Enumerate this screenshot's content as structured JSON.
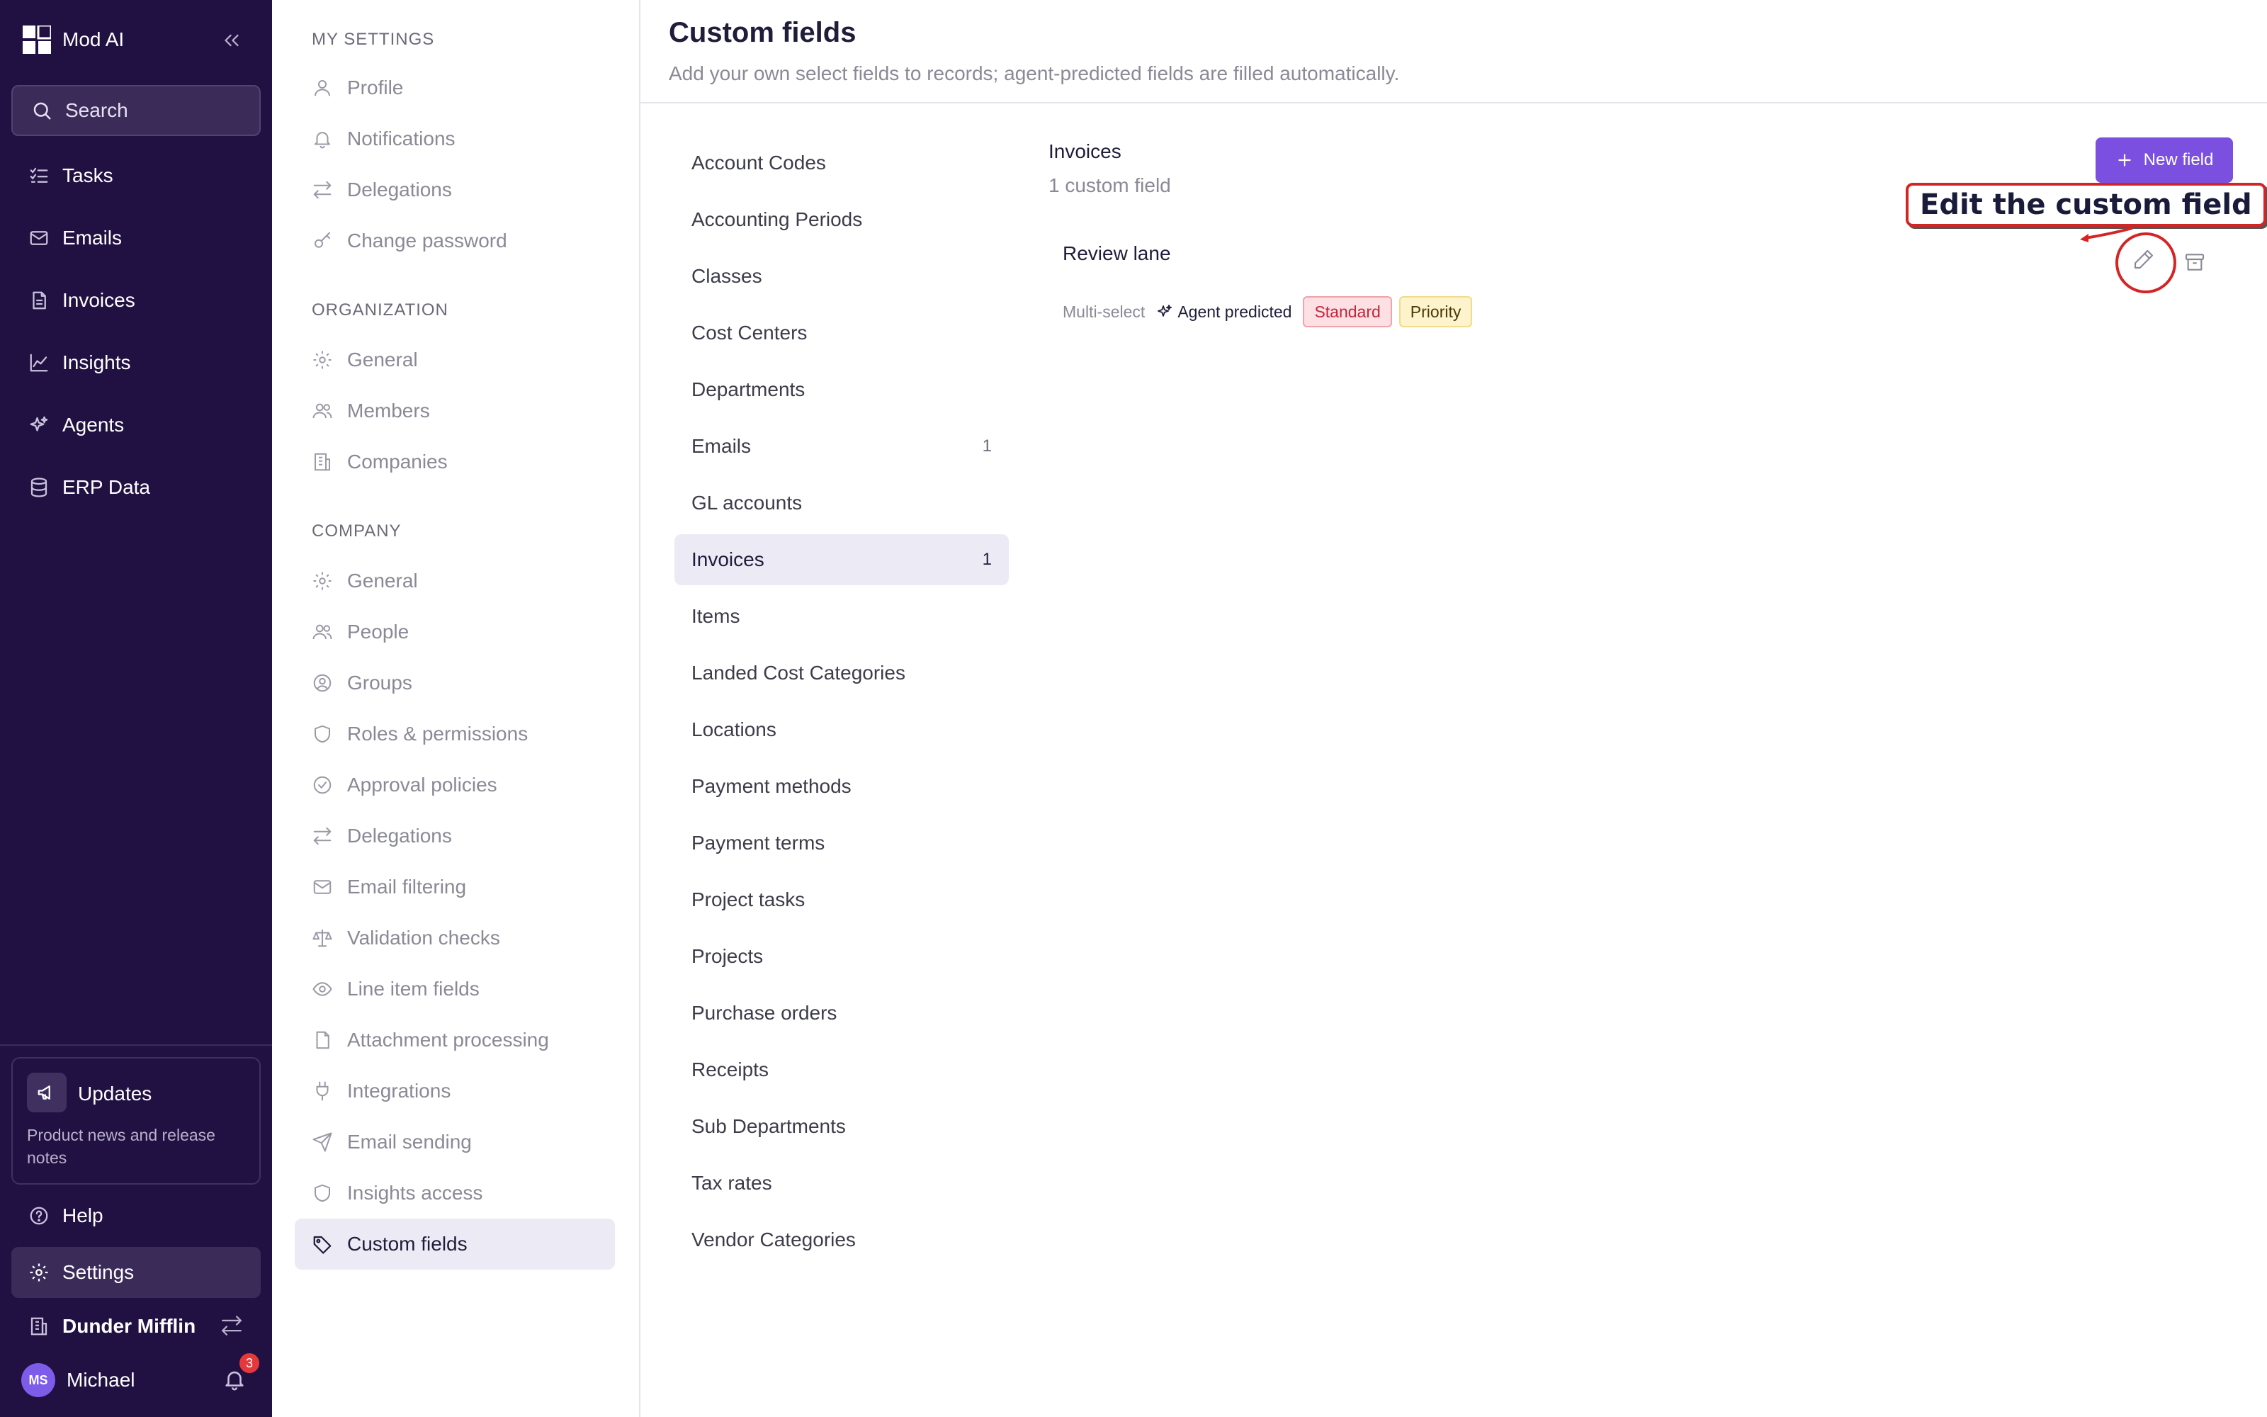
{
  "app": {
    "name": "Mod AI",
    "search_label": "Search"
  },
  "sidebar": {
    "nav": [
      {
        "label": "Tasks",
        "icon": "tasks-icon"
      },
      {
        "label": "Emails",
        "icon": "mail-icon"
      },
      {
        "label": "Invoices",
        "icon": "invoice-icon"
      },
      {
        "label": "Insights",
        "icon": "chart-icon"
      },
      {
        "label": "Agents",
        "icon": "sparkles-icon"
      },
      {
        "label": "ERP Data",
        "icon": "database-icon"
      }
    ],
    "updates": {
      "title": "Updates",
      "description": "Product news and release notes"
    },
    "help_label": "Help",
    "settings_label": "Settings",
    "org_name": "Dunder Mifflin",
    "user": {
      "initials": "MS",
      "name": "Michael",
      "notification_count": "3"
    }
  },
  "settings_menu": {
    "my_settings": {
      "heading": "MY SETTINGS",
      "items": [
        {
          "label": "Profile",
          "icon": "user-icon"
        },
        {
          "label": "Notifications",
          "icon": "bell-icon"
        },
        {
          "label": "Delegations",
          "icon": "swap-icon"
        },
        {
          "label": "Change password",
          "icon": "key-icon"
        }
      ]
    },
    "organization": {
      "heading": "ORGANIZATION",
      "items": [
        {
          "label": "General",
          "icon": "gear-icon"
        },
        {
          "label": "Members",
          "icon": "users-icon"
        },
        {
          "label": "Companies",
          "icon": "building-icon"
        }
      ]
    },
    "company": {
      "heading": "COMPANY",
      "items": [
        {
          "label": "General",
          "icon": "gear-icon"
        },
        {
          "label": "People",
          "icon": "users-icon"
        },
        {
          "label": "Groups",
          "icon": "user-circle-icon"
        },
        {
          "label": "Roles & permissions",
          "icon": "shield-icon"
        },
        {
          "label": "Approval policies",
          "icon": "check-circle-icon"
        },
        {
          "label": "Delegations",
          "icon": "swap-icon"
        },
        {
          "label": "Email filtering",
          "icon": "mail-icon"
        },
        {
          "label": "Validation checks",
          "icon": "scale-icon"
        },
        {
          "label": "Line item fields",
          "icon": "eye-icon"
        },
        {
          "label": "Attachment processing",
          "icon": "file-icon"
        },
        {
          "label": "Integrations",
          "icon": "plug-icon"
        },
        {
          "label": "Email sending",
          "icon": "send-icon"
        },
        {
          "label": "Insights access",
          "icon": "shield-icon"
        },
        {
          "label": "Custom fields",
          "icon": "tag-icon"
        }
      ]
    }
  },
  "main": {
    "title": "Custom fields",
    "subtitle": "Add your own select fields to records; agent-predicted fields are filled automatically.",
    "categories": [
      {
        "label": "Account Codes",
        "count": ""
      },
      {
        "label": "Accounting Periods",
        "count": ""
      },
      {
        "label": "Classes",
        "count": ""
      },
      {
        "label": "Cost Centers",
        "count": ""
      },
      {
        "label": "Departments",
        "count": ""
      },
      {
        "label": "Emails",
        "count": "1"
      },
      {
        "label": "GL accounts",
        "count": ""
      },
      {
        "label": "Invoices",
        "count": "1"
      },
      {
        "label": "Items",
        "count": ""
      },
      {
        "label": "Landed Cost Categories",
        "count": ""
      },
      {
        "label": "Locations",
        "count": ""
      },
      {
        "label": "Payment methods",
        "count": ""
      },
      {
        "label": "Payment terms",
        "count": ""
      },
      {
        "label": "Project tasks",
        "count": ""
      },
      {
        "label": "Projects",
        "count": ""
      },
      {
        "label": "Purchase orders",
        "count": ""
      },
      {
        "label": "Receipts",
        "count": ""
      },
      {
        "label": "Sub Departments",
        "count": ""
      },
      {
        "label": "Tax rates",
        "count": ""
      },
      {
        "label": "Vendor Categories",
        "count": ""
      }
    ],
    "detail": {
      "title": "Invoices",
      "subtitle": "1 custom field",
      "new_field_label": "New field",
      "field": {
        "name": "Review lane",
        "type": "Multi-select",
        "agent_label": "Agent predicted",
        "options": [
          "Standard",
          "Priority"
        ]
      }
    }
  },
  "annotation": {
    "label": "Edit the custom field",
    "color": "#d42525"
  },
  "colors": {
    "sidebar_bg": "#211142",
    "accent": "#7b4fe0",
    "active_bg": "#eceaf4"
  }
}
